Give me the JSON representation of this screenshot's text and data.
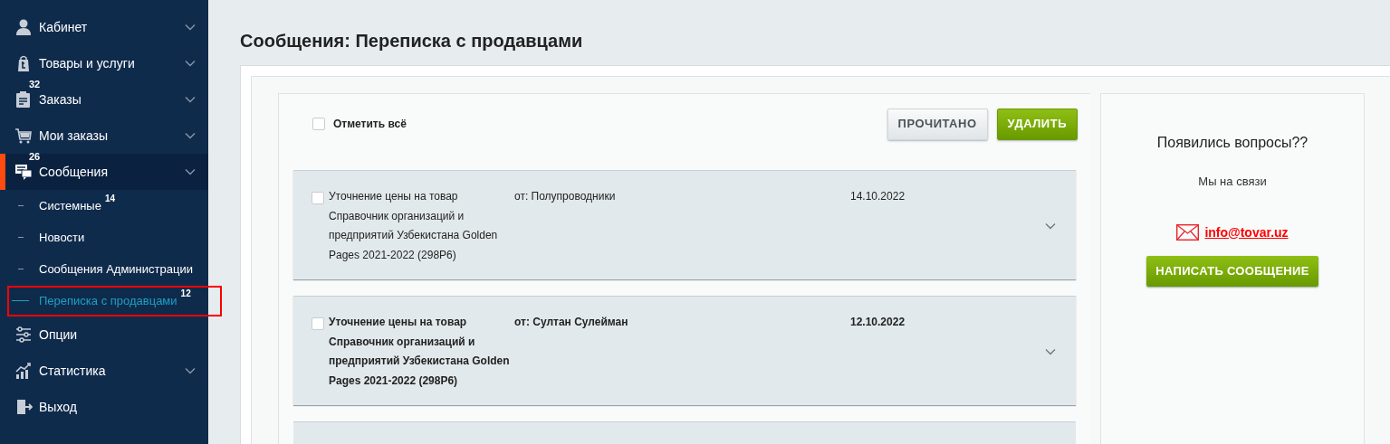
{
  "sidebar": {
    "items": [
      {
        "label": "Кабинет",
        "expandable": true,
        "selected": false
      },
      {
        "label": "Товары и услуги",
        "expandable": true,
        "selected": false
      },
      {
        "label": "Заказы",
        "badge": "32",
        "expandable": true,
        "selected": false
      },
      {
        "label": "Мои заказы",
        "expandable": true,
        "selected": false
      },
      {
        "label": "Сообщения",
        "badge": "26",
        "expandable": true,
        "selected": true,
        "children": [
          {
            "label": "Системные",
            "badge": "14",
            "selected": false
          },
          {
            "label": "Новости",
            "selected": false
          },
          {
            "label": "Сообщения Администрации",
            "selected": false
          },
          {
            "label": "Переписка с продавцами",
            "badge": "12",
            "selected": true
          }
        ]
      },
      {
        "label": "Опции",
        "expandable": false,
        "selected": false
      },
      {
        "label": "Статистика",
        "expandable": true,
        "selected": false
      },
      {
        "label": "Выход",
        "expandable": false,
        "selected": false
      }
    ]
  },
  "page": {
    "title": "Сообщения: Переписка с продавцами"
  },
  "toolbar": {
    "select_all": {
      "label": "Отметить всё",
      "checked": false
    },
    "buttons": [
      {
        "label": "ПРОЧИТАНО",
        "kind": "secondary"
      },
      {
        "label": "УДАЛИТЬ",
        "kind": "primary"
      }
    ]
  },
  "messages": [
    {
      "subject": "Уточнение цены на товар Справочник организаций и предприятий Узбекистана Golden Pages 2021-2022 (298Р6)",
      "from": "от: Полупроводники",
      "date": "14.10.2022",
      "checked": false,
      "unread": false
    },
    {
      "subject": "Уточнение цены на товар Справочник организаций и предприятий Узбекистана Golden Pages 2021-2022 (298Р6)",
      "from": "от: Султан Сулейман",
      "date": "12.10.2022",
      "checked": false,
      "unread": true
    },
    {
      "kind": "partial"
    }
  ],
  "contact": {
    "title": "Появились вопросы??",
    "subtitle": "Мы на связи",
    "email": "info@tovar.uz",
    "button": "НАПИСАТЬ СООБЩЕНИЕ"
  }
}
